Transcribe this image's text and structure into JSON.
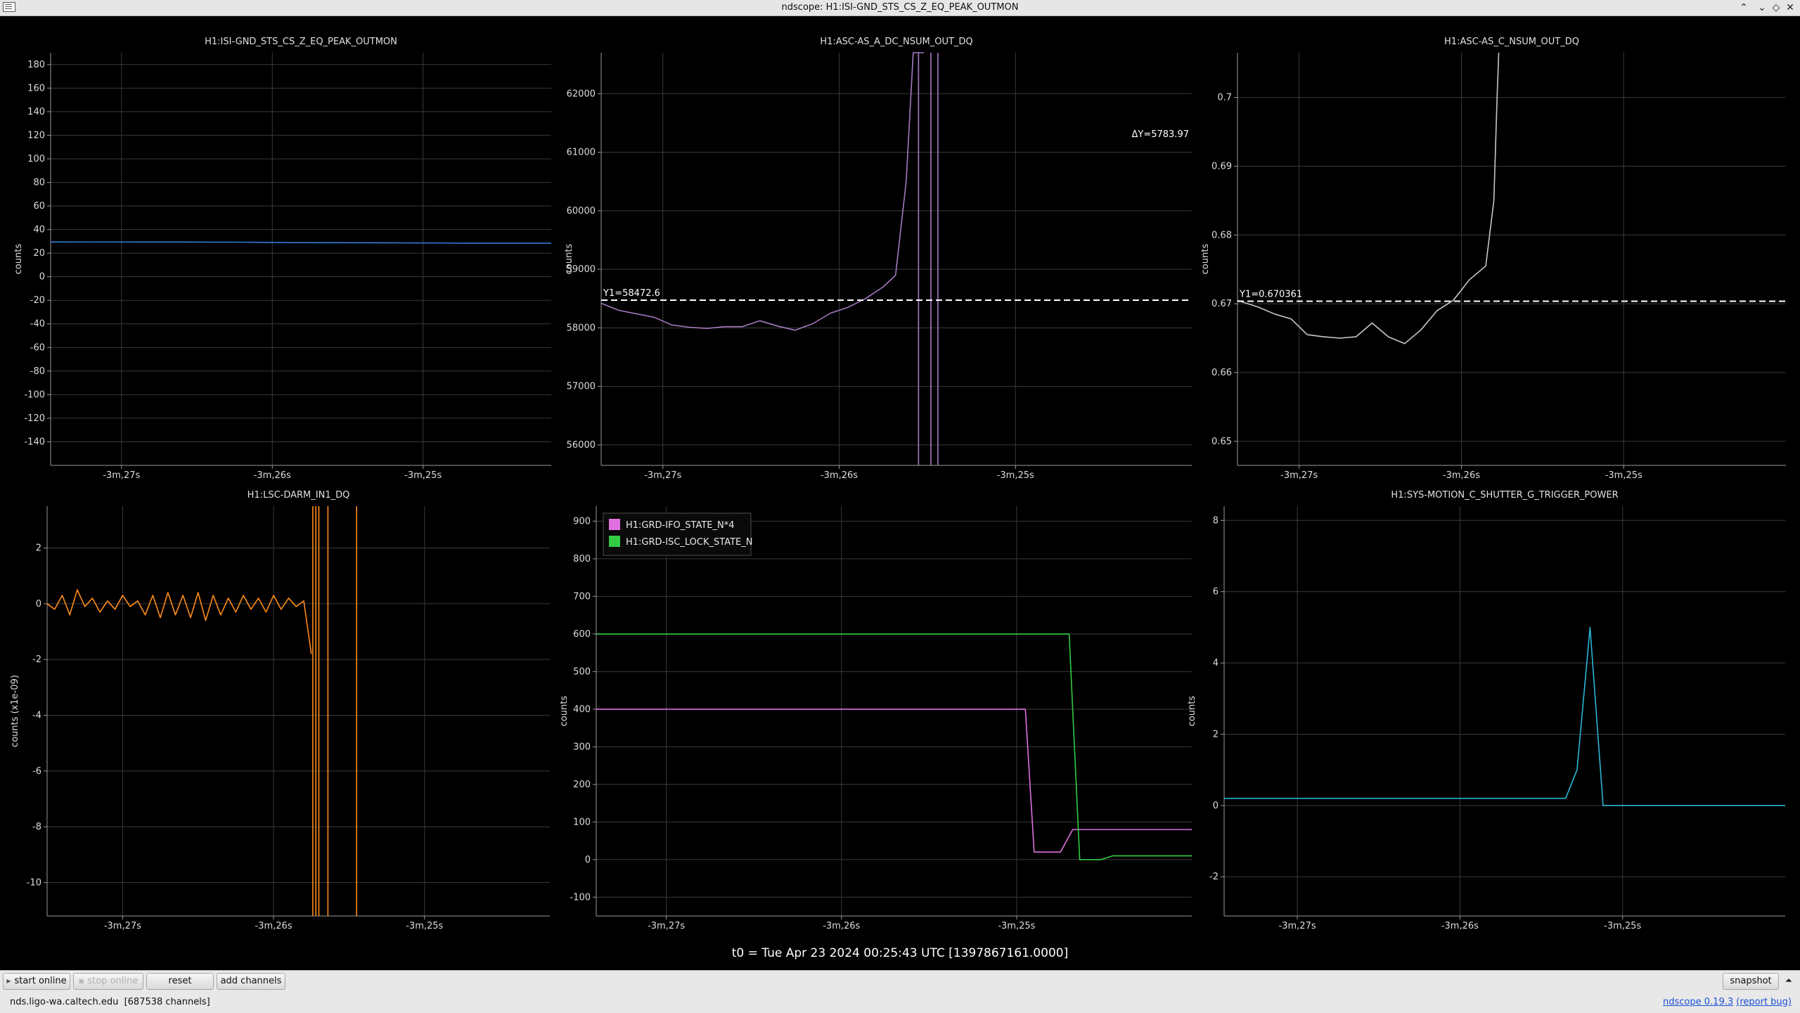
{
  "window": {
    "title": "ndscope: H1:ISI-GND_STS_CS_Z_EQ_PEAK_OUTMON"
  },
  "colors": {
    "plot_bg": "#000000",
    "axis": "#9a9a9a",
    "grid": "#3a3a3a",
    "cursor": "#ffffff"
  },
  "time_axis": {
    "ticks": [
      -207,
      -206,
      -205
    ],
    "tick_labels": [
      "-3m,27s",
      "-3m,26s",
      "-3m,25s"
    ]
  },
  "t0_label": "t0 = Tue Apr 23 2024 00:25:43 UTC [1397867161.0000]",
  "chart_data": [
    {
      "type": "line",
      "title": "H1:ISI-GND_STS_CS_Z_EQ_PEAK_OUTMON",
      "ylabel": "counts",
      "xlim": [
        -207.47,
        -204.15
      ],
      "ylim": [
        -160,
        190
      ],
      "yticks": [
        -140,
        -120,
        -100,
        -80,
        -60,
        -40,
        -20,
        0,
        20,
        40,
        60,
        80,
        100,
        120,
        140,
        160,
        180
      ],
      "series": [
        {
          "color": "#2f7ed8",
          "x": [
            -207.47,
            -206.8,
            -206.2,
            -205.8,
            -205.2,
            -204.7,
            -204.15
          ],
          "y": [
            29.5,
            29.4,
            29.3,
            28.9,
            28.8,
            28.5,
            28.5
          ]
        }
      ]
    },
    {
      "type": "line",
      "title": "H1:ASC-AS_A_DC_NSUM_OUT_DQ",
      "ylabel": "counts",
      "xlim": [
        -207.35,
        -204.0
      ],
      "ylim": [
        55650,
        62700
      ],
      "yticks": [
        56000,
        57000,
        58000,
        59000,
        60000,
        61000,
        62000
      ],
      "annotations": [
        {
          "label": "Y1=58472.6",
          "y": 58472.6,
          "style": "dashed-line"
        },
        {
          "label": "ΔY=5783.97",
          "style": "text"
        }
      ],
      "series": [
        {
          "color": "#a678c2",
          "x": [
            -207.35,
            -207.25,
            -207.15,
            -207.05,
            -206.95,
            -206.85,
            -206.75,
            -206.65,
            -206.55,
            -206.45,
            -206.35,
            -206.25,
            -206.15,
            -206.05,
            -205.95,
            -205.85,
            -205.75,
            -205.68,
            -205.62,
            -205.58,
            -205.55,
            -205.53,
            -205.52
          ],
          "y": [
            58420,
            58300,
            58240,
            58180,
            58050,
            58010,
            57990,
            58020,
            58020,
            58120,
            58030,
            57960,
            58070,
            58250,
            58350,
            58500,
            58700,
            58900,
            60500,
            62700,
            62700,
            62700,
            62700
          ]
        },
        {
          "color": "#a678c2",
          "vlines": [
            -205.55,
            -205.48,
            -205.44
          ]
        }
      ]
    },
    {
      "type": "line",
      "title": "H1:ASC-AS_C_NSUM_OUT_DQ",
      "ylabel": "counts",
      "xlim": [
        -207.38,
        -204.0
      ],
      "ylim": [
        0.6465,
        0.7065
      ],
      "yticks": [
        0.65,
        0.66,
        0.67,
        0.68,
        0.69,
        0.7
      ],
      "annotations": [
        {
          "label": "Y1=0.670361",
          "y": 0.670361,
          "style": "dashed-line"
        }
      ],
      "series": [
        {
          "color": "#c8c8c8",
          "x": [
            -207.38,
            -207.25,
            -207.15,
            -207.05,
            -206.95,
            -206.85,
            -206.75,
            -206.65,
            -206.55,
            -206.45,
            -206.35,
            -206.25,
            -206.15,
            -206.05,
            -205.95,
            -205.85,
            -205.8,
            -205.78,
            -205.77
          ],
          "y": [
            0.6705,
            0.6695,
            0.6685,
            0.6678,
            0.6655,
            0.6652,
            0.665,
            0.6652,
            0.6672,
            0.6652,
            0.6642,
            0.6662,
            0.669,
            0.6705,
            0.6735,
            0.6755,
            0.685,
            0.7,
            0.7065
          ]
        }
      ]
    },
    {
      "type": "line",
      "title": "H1:LSC-DARM_IN1_DQ",
      "ylabel": "counts (x1e-09)",
      "xlim": [
        -207.5,
        -204.17
      ],
      "ylim": [
        -11.2,
        3.5
      ],
      "yticks": [
        -10,
        -8,
        -6,
        -4,
        -2,
        0,
        2
      ],
      "series": [
        {
          "color": "#ff8c1a",
          "x": [
            -207.5,
            -207.45,
            -207.4,
            -207.35,
            -207.3,
            -207.25,
            -207.2,
            -207.15,
            -207.1,
            -207.05,
            -207.0,
            -206.95,
            -206.9,
            -206.85,
            -206.8,
            -206.75,
            -206.7,
            -206.65,
            -206.6,
            -206.55,
            -206.5,
            -206.45,
            -206.4,
            -206.35,
            -206.3,
            -206.25,
            -206.2,
            -206.15,
            -206.1,
            -206.05,
            -206.0,
            -205.95,
            -205.9,
            -205.85,
            -205.8,
            -205.75
          ],
          "y": [
            0.0,
            -0.2,
            0.3,
            -0.4,
            0.5,
            -0.1,
            0.2,
            -0.3,
            0.1,
            -0.2,
            0.3,
            -0.1,
            0.1,
            -0.4,
            0.3,
            -0.5,
            0.4,
            -0.4,
            0.3,
            -0.5,
            0.4,
            -0.6,
            0.3,
            -0.4,
            0.2,
            -0.3,
            0.3,
            -0.2,
            0.2,
            -0.3,
            0.3,
            -0.2,
            0.2,
            -0.1,
            0.1,
            -1.8
          ]
        },
        {
          "color": "#ff8c1a",
          "vlines": [
            -205.74,
            -205.72,
            -205.7,
            -205.64,
            -205.45
          ]
        }
      ]
    },
    {
      "type": "line",
      "title": "",
      "ylabel": "counts",
      "xlim": [
        -207.4,
        -204.0
      ],
      "ylim": [
        -150,
        940
      ],
      "yticks": [
        -100,
        0,
        100,
        200,
        300,
        400,
        500,
        600,
        700,
        800,
        900
      ],
      "legend": {
        "placement": "top-left",
        "entries": [
          "H1:GRD-IFO_STATE_N*4",
          "H1:GRD-ISC_LOCK_STATE_N"
        ]
      },
      "series": [
        {
          "name": "H1:GRD-IFO_STATE_N*4",
          "color": "#e070e0",
          "x": [
            -207.4,
            -204.95,
            -204.9,
            -204.75,
            -204.68,
            -204.0
          ],
          "y": [
            400,
            400,
            20,
            20,
            80,
            80
          ]
        },
        {
          "name": "H1:GRD-ISC_LOCK_STATE_N",
          "color": "#33cc44",
          "x": [
            -207.4,
            -204.7,
            -204.64,
            -204.52,
            -204.45,
            -204.0
          ],
          "y": [
            600,
            600,
            0,
            0,
            10,
            10
          ]
        }
      ]
    },
    {
      "type": "line",
      "title": "H1:SYS-MOTION_C_SHUTTER_G_TRIGGER_POWER",
      "ylabel": "counts",
      "xlim": [
        -207.45,
        -204.0
      ],
      "ylim": [
        -3.1,
        8.4
      ],
      "yticks": [
        -2,
        0,
        2,
        4,
        6,
        8
      ],
      "series": [
        {
          "color": "#29b6d8",
          "x": [
            -207.45,
            -205.35,
            -205.28,
            -205.2,
            -205.12,
            -205.05,
            -204.5,
            -204.0
          ],
          "y": [
            0.2,
            0.2,
            1.0,
            5.0,
            0.0,
            0.0,
            0.0,
            0.0
          ]
        }
      ]
    }
  ],
  "toolbar": {
    "start_online": "start online",
    "stop_online": "stop online",
    "reset": "reset",
    "add_channels": "add channels",
    "snapshot": "snapshot"
  },
  "status": {
    "server": "nds.ligo-wa.caltech.edu",
    "channels": "[687538 channels]",
    "version_link": "ndscope 0.19.3",
    "report": "(report bug)"
  }
}
